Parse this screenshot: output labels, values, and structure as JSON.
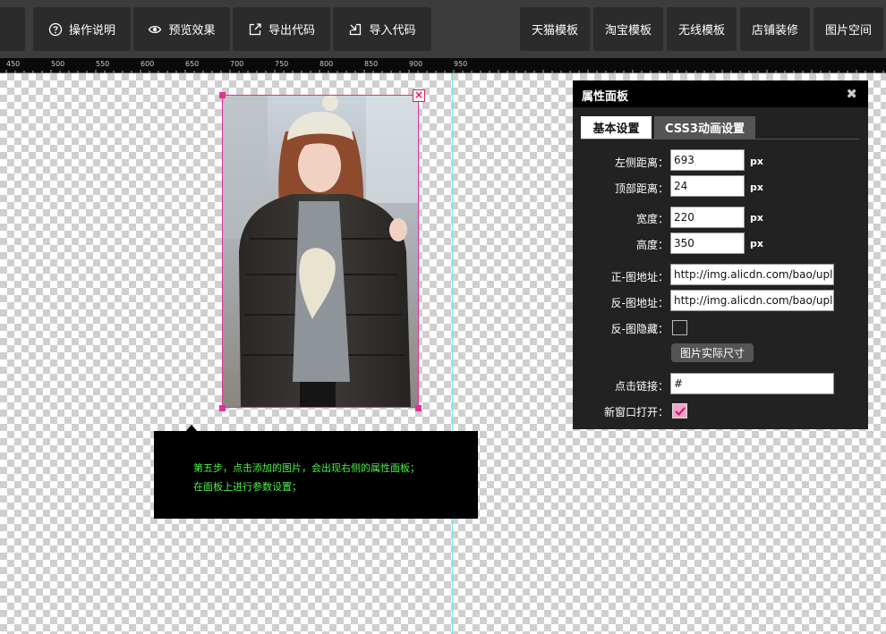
{
  "toolbar": {
    "left_buttons": [
      {
        "label": "操作说明",
        "icon": "help-circle-icon"
      },
      {
        "label": "预览效果",
        "icon": "eye-icon"
      },
      {
        "label": "导出代码",
        "icon": "export-icon"
      },
      {
        "label": "导入代码",
        "icon": "import-icon"
      }
    ],
    "right_buttons": [
      {
        "label": "天猫模板"
      },
      {
        "label": "淘宝模板"
      },
      {
        "label": "无线模板"
      },
      {
        "label": "店铺装修"
      },
      {
        "label": "图片空间"
      }
    ]
  },
  "ruler": {
    "ticks": [
      "450",
      "500",
      "550",
      "600",
      "650",
      "700",
      "750",
      "800",
      "850",
      "900",
      "950"
    ]
  },
  "canvas": {
    "image_alt": "girl-in-black-jacket-photo",
    "delete_icon": "close-x-icon"
  },
  "tip": {
    "line1": "第五步，点击添加的图片，会出现右侧的属性面板；",
    "line2": "在面板上进行参数设置；"
  },
  "panel": {
    "title": "属性面板",
    "close_icon": "close-icon",
    "tabs": [
      {
        "label": "基本设置",
        "active": true
      },
      {
        "label": "CSS3动画设置",
        "active": false
      }
    ],
    "fields": {
      "left": {
        "label": "左侧距离：",
        "value": "693",
        "unit": "px"
      },
      "top": {
        "label": "顶部距离：",
        "value": "24",
        "unit": "px"
      },
      "width": {
        "label": "宽度：",
        "value": "220",
        "unit": "px"
      },
      "height": {
        "label": "高度：",
        "value": "350",
        "unit": "px"
      },
      "front_url": {
        "label": "正-图地址：",
        "value": "http://img.alicdn.com/bao/uplc"
      },
      "back_url": {
        "label": "反-图地址：",
        "value": "http://img.alicdn.com/bao/uplc"
      },
      "back_hide": {
        "label": "反-图隐藏：",
        "checked": false
      },
      "real_size_button": "图片实际尺寸",
      "link": {
        "label": "点击链接：",
        "value": "#"
      },
      "new_window": {
        "label": "新窗口打开：",
        "checked": true
      }
    }
  },
  "colors": {
    "toolbar_bg": "#3c3c3c",
    "button_bg": "#2b2b2b",
    "selection": "#e0309a",
    "guide": "#7fe3e3",
    "tip_text": "#4ef04e",
    "panel_bg": "#222222"
  }
}
